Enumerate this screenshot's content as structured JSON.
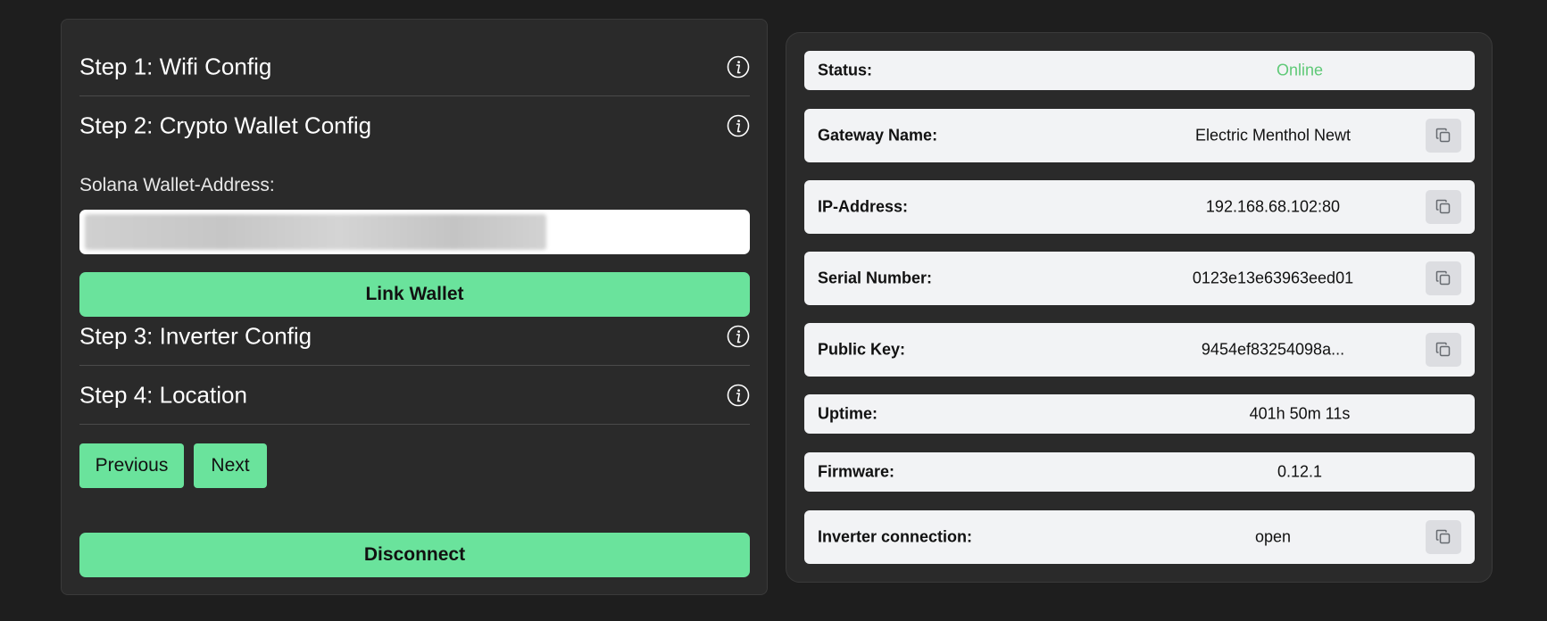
{
  "wizard": {
    "steps": [
      {
        "title": "Step 1: Wifi Config"
      },
      {
        "title": "Step 2: Crypto Wallet Config"
      },
      {
        "title": "Step 3: Inverter Config"
      },
      {
        "title": "Step 4: Location"
      }
    ],
    "wallet_label": "Solana Wallet-Address:",
    "link_wallet_label": "Link Wallet",
    "previous_label": "Previous",
    "next_label": "Next",
    "disconnect_label": "Disconnect"
  },
  "device_info": {
    "rows": [
      {
        "label": "Status:",
        "value": "Online",
        "copyable": false
      },
      {
        "label": "Gateway Name:",
        "value": "Electric Menthol Newt",
        "copyable": true
      },
      {
        "label": "IP-Address:",
        "value": "192.168.68.102:80",
        "copyable": true
      },
      {
        "label": "Serial Number:",
        "value": "0123e13e63963eed01",
        "copyable": true
      },
      {
        "label": "Public Key:",
        "value": "9454ef83254098a...",
        "copyable": true
      },
      {
        "label": "Uptime:",
        "value": "401h 50m 11s",
        "copyable": false
      },
      {
        "label": "Firmware:",
        "value": "0.12.1",
        "copyable": false
      },
      {
        "label": "Inverter connection:",
        "value": "open",
        "copyable": true
      }
    ]
  },
  "colors": {
    "accent_green": "#6ae39c",
    "status_online": "#5fc977",
    "background": "#1e1e1e",
    "panel": "#2a2a2a"
  },
  "icons": {
    "info": "info-circle-icon",
    "copy": "copy-icon"
  }
}
